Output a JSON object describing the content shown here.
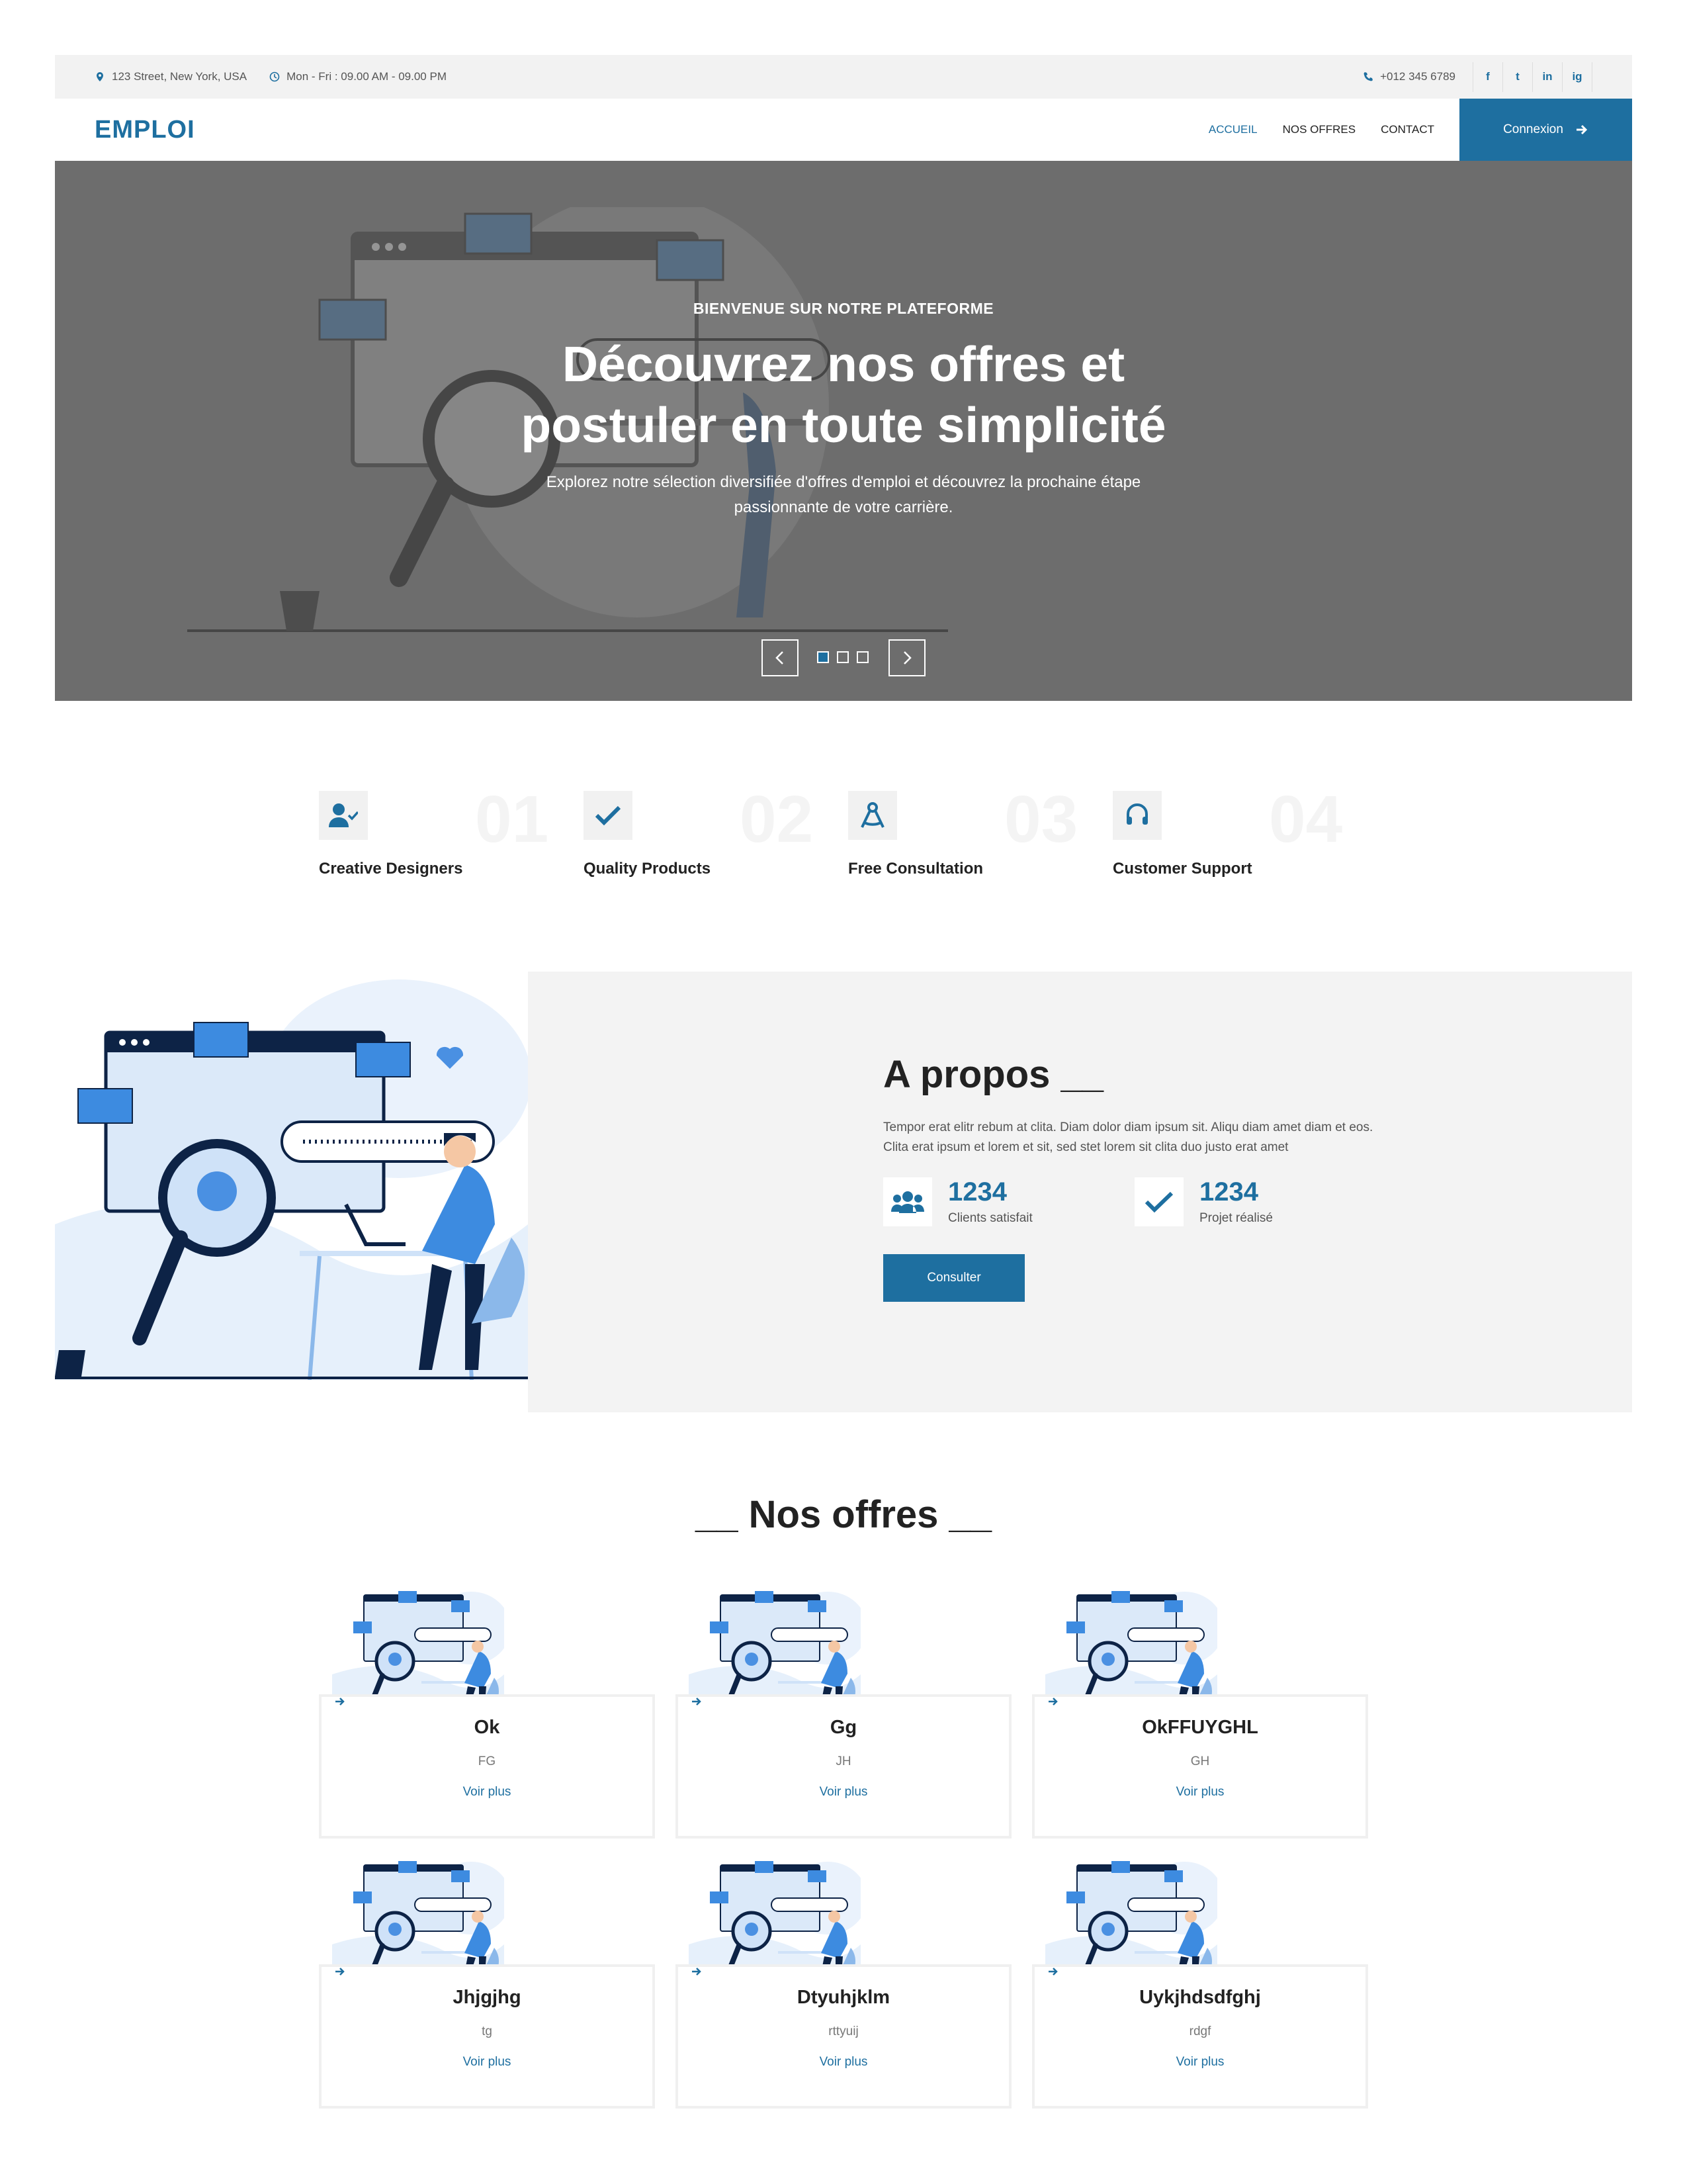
{
  "topbar": {
    "address": "123 Street, New York, USA",
    "hours": "Mon - Fri : 09.00 AM - 09.00 PM",
    "phone": "+012 345 6789",
    "social": [
      "f",
      "t",
      "in",
      "ig"
    ]
  },
  "nav": {
    "logo": "EMPLOI",
    "items": [
      "ACCUEIL",
      "NOS OFFRES",
      "CONTACT"
    ],
    "active": "ACCUEIL",
    "login": "Connexion"
  },
  "hero": {
    "kicker": "BIENVENUE SUR NOTRE PLATEFORME",
    "title_line1": "Découvrez nos offres et",
    "title_line2": "postuler en toute simplicité",
    "subtitle": "Explorez notre sélection diversifiée d'offres d'emploi et découvrez la prochaine étape passionnante de votre carrière.",
    "slides": 3,
    "active_slide": 1
  },
  "features": [
    {
      "label": "Creative Designers",
      "num": "01",
      "icon": "user-check-icon"
    },
    {
      "label": "Quality Products",
      "num": "02",
      "icon": "check-icon"
    },
    {
      "label": "Free Consultation",
      "num": "03",
      "icon": "drafting-compass-icon"
    },
    {
      "label": "Customer Support",
      "num": "04",
      "icon": "headset-icon"
    }
  ],
  "about": {
    "title": "A propos __",
    "text": "Tempor erat elitr rebum at clita. Diam dolor diam ipsum sit. Aliqu diam amet diam et eos. Clita erat ipsum et lorem et sit, sed stet lorem sit clita duo justo erat amet",
    "stats": [
      {
        "value": "1234",
        "caption": "Clients satisfait",
        "icon": "users-icon"
      },
      {
        "value": "1234",
        "caption": "Projet réalisé",
        "icon": "check-icon"
      }
    ],
    "button": "Consulter"
  },
  "offers": {
    "title": "__ Nos offres __",
    "more_label": "Voir plus",
    "items": [
      {
        "title": "Ok",
        "sub": "FG"
      },
      {
        "title": "Gg",
        "sub": "JH"
      },
      {
        "title": "OkFFUYGHL",
        "sub": "GH"
      },
      {
        "title": "Jhjgjhg",
        "sub": "tg"
      },
      {
        "title": "Dtyuhjklm",
        "sub": "rttyuij"
      },
      {
        "title": "Uykjhdsdfghj",
        "sub": "rdgf"
      }
    ]
  },
  "colors": {
    "accent": "#1e6fa0",
    "hero_overlay": "#6d6d6d",
    "light_panel": "#f3f3f3"
  }
}
